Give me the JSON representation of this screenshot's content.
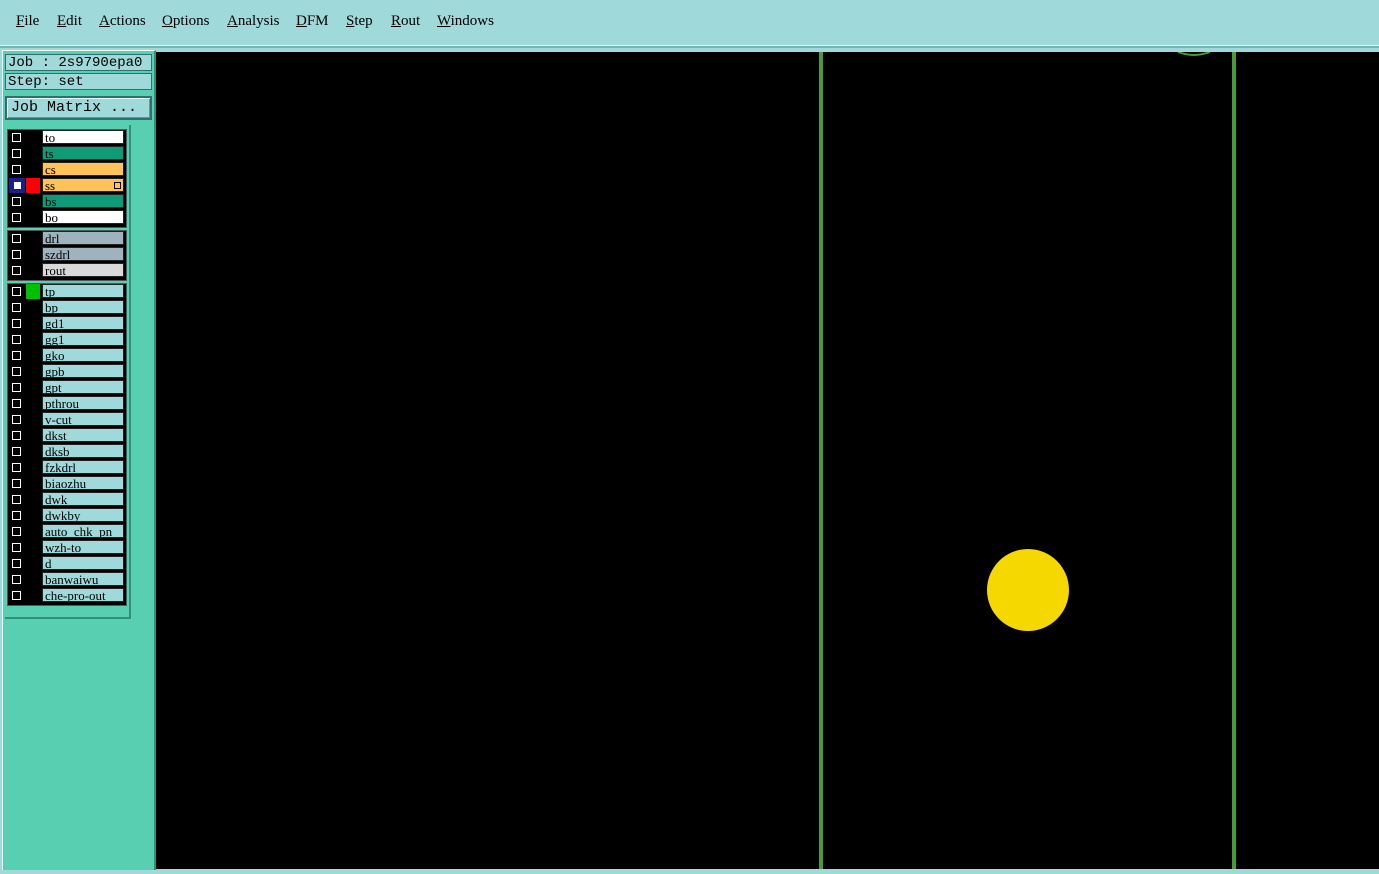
{
  "menubar": {
    "items": [
      "File",
      "Edit",
      "Actions",
      "Options",
      "Analysis",
      "DFM",
      "Step",
      "Rout",
      "Windows"
    ]
  },
  "job": {
    "job_label": "Job : 2s9790epa0",
    "step_label": "Step: set",
    "matrix_button": "Job Matrix ..."
  },
  "layer_groups": [
    {
      "layers": [
        {
          "name": "to",
          "bg": "#ffffff",
          "color": "#000000"
        },
        {
          "name": "ts",
          "bg": "#0f9a78",
          "color": "#000000"
        },
        {
          "name": "cs",
          "bg": "#ffc35a",
          "color": "#000000"
        },
        {
          "name": "ss",
          "bg": "#ffc35a",
          "color": "#ff0000",
          "selected": true,
          "marker": true
        },
        {
          "name": "bs",
          "bg": "#0f9a78",
          "color": "#000000"
        },
        {
          "name": "bo",
          "bg": "#ffffff",
          "color": "#000000"
        }
      ]
    },
    {
      "layers": [
        {
          "name": "drl",
          "bg": "#9fb3bf",
          "color": "#000000"
        },
        {
          "name": "szdrl",
          "bg": "#9fb3bf",
          "color": "#000000"
        },
        {
          "name": "rout",
          "bg": "#d9d9d9",
          "color": "#000000"
        }
      ]
    },
    {
      "layers": [
        {
          "name": "tp",
          "bg": "#9fd9d9",
          "color": "#00c000"
        },
        {
          "name": "bp",
          "bg": "#9fd9d9",
          "color": "#000000"
        },
        {
          "name": "gd1",
          "bg": "#9fd9d9",
          "color": "#000000"
        },
        {
          "name": "gg1",
          "bg": "#9fd9d9",
          "color": "#000000"
        },
        {
          "name": "gko",
          "bg": "#9fd9d9",
          "color": "#000000"
        },
        {
          "name": "gpb",
          "bg": "#9fd9d9",
          "color": "#000000"
        },
        {
          "name": "gpt",
          "bg": "#9fd9d9",
          "color": "#000000"
        },
        {
          "name": "pthrou",
          "bg": "#9fd9d9",
          "color": "#000000"
        },
        {
          "name": "v-cut",
          "bg": "#9fd9d9",
          "color": "#000000"
        },
        {
          "name": "dkst",
          "bg": "#9fd9d9",
          "color": "#000000"
        },
        {
          "name": "dksb",
          "bg": "#9fd9d9",
          "color": "#000000"
        },
        {
          "name": "fzkdrl",
          "bg": "#9fd9d9",
          "color": "#000000"
        },
        {
          "name": "biaozhu",
          "bg": "#9fd9d9",
          "color": "#000000"
        },
        {
          "name": "dwk",
          "bg": "#9fd9d9",
          "color": "#000000"
        },
        {
          "name": "dwkby",
          "bg": "#9fd9d9",
          "color": "#000000"
        },
        {
          "name": "auto_chk_pn",
          "bg": "#9fd9d9",
          "color": "#000000"
        },
        {
          "name": "wzh-to",
          "bg": "#9fd9d9",
          "color": "#000000"
        },
        {
          "name": "d",
          "bg": "#9fd9d9",
          "color": "#000000"
        },
        {
          "name": "banwaiwu",
          "bg": "#9fd9d9",
          "color": "#000000"
        },
        {
          "name": "che-pro-out",
          "bg": "#9fd9d9",
          "color": "#000000"
        }
      ]
    }
  ],
  "canvas": {
    "background": "#000000",
    "line_color": "#4a9a3a",
    "pad_color": "#f5d800"
  }
}
